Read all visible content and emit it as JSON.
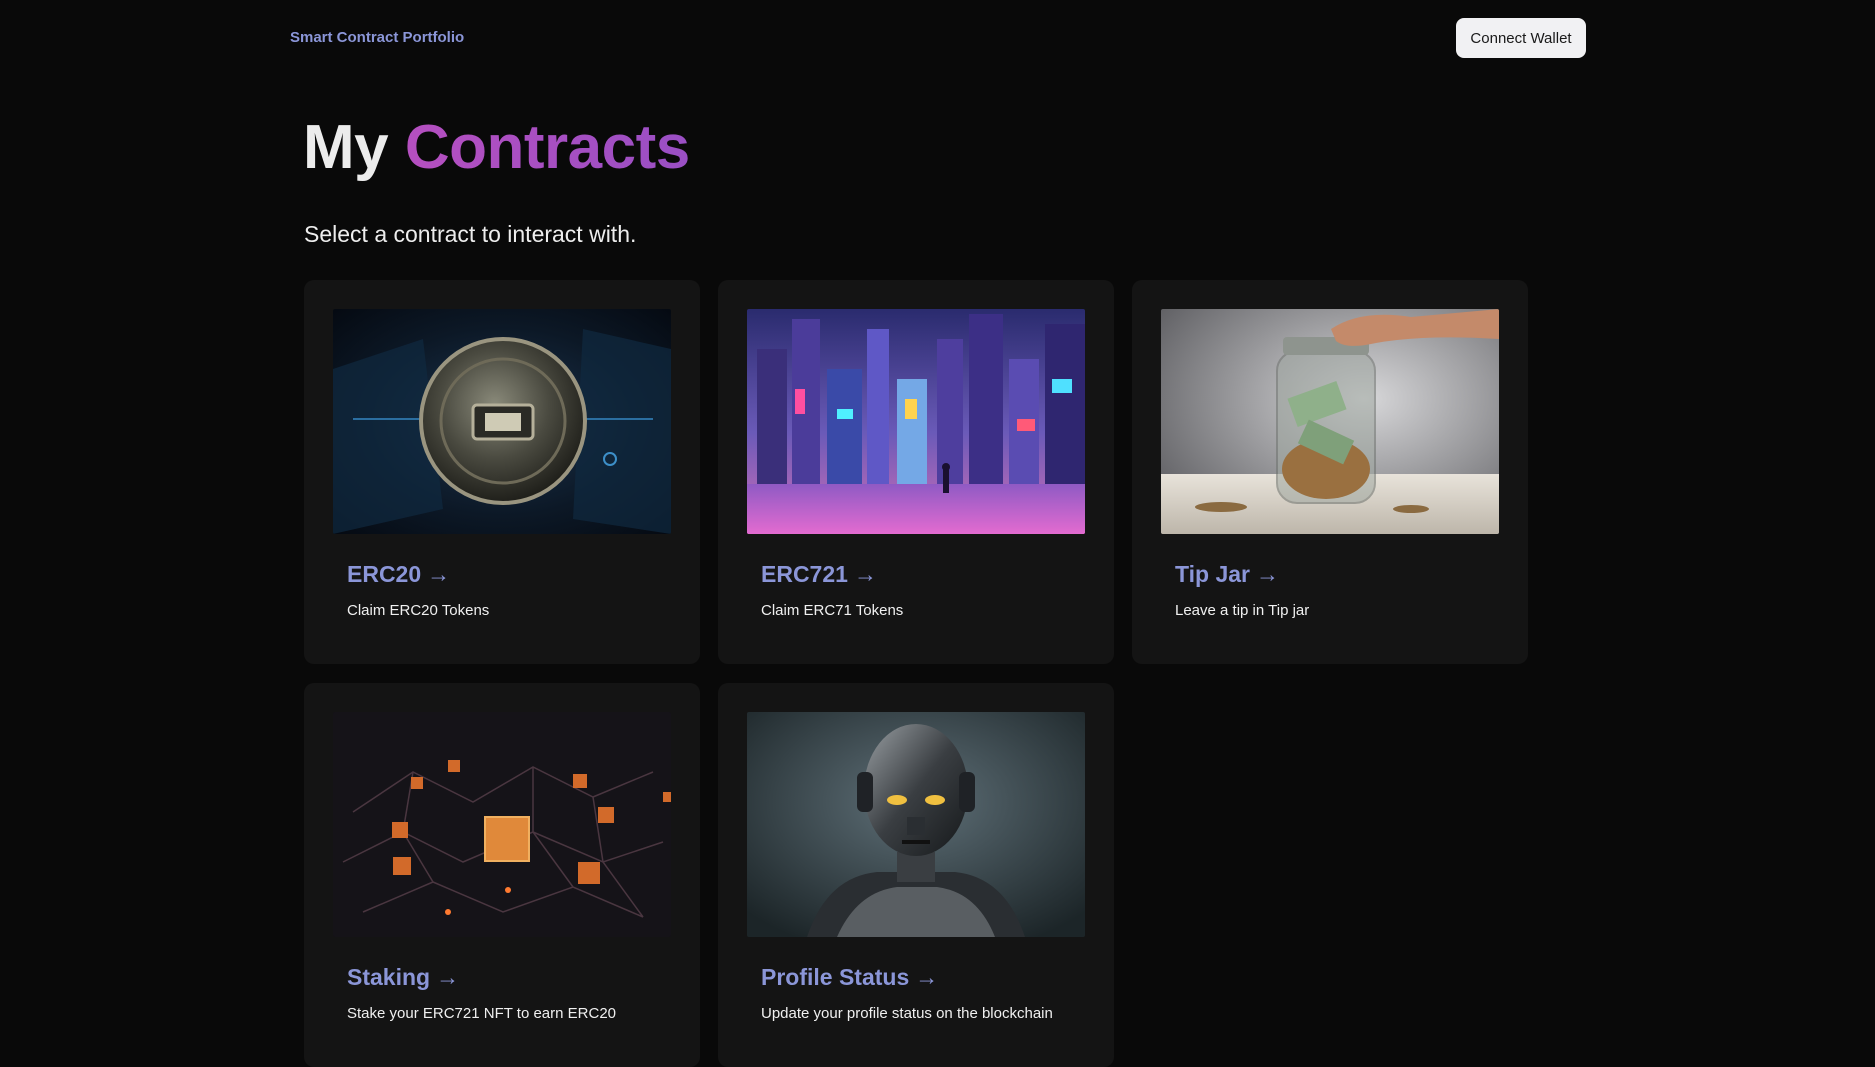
{
  "header": {
    "brand": "Smart Contract Portfolio",
    "connect_label": "Connect Wallet"
  },
  "main": {
    "title_word1": "My",
    "title_word2": "Contracts",
    "subtitle": "Select a contract to interact with."
  },
  "cards": [
    {
      "title": "ERC20",
      "arrow": "→",
      "description": "Claim ERC20 Tokens",
      "image": "coin-image"
    },
    {
      "title": "ERC721",
      "arrow": "→",
      "description": "Claim ERC71 Tokens",
      "image": "cyberpunk-city-image"
    },
    {
      "title": "Tip Jar",
      "arrow": "→",
      "description": "Leave a tip in Tip jar",
      "image": "tip-jar-image"
    },
    {
      "title": "Staking",
      "arrow": "→",
      "description": "Stake your ERC721 NFT to earn ERC20",
      "image": "blockchain-cubes-image"
    },
    {
      "title": "Profile Status",
      "arrow": "→",
      "description": "Update your profile status on the blockchain",
      "image": "robot-image"
    }
  ],
  "colors": {
    "background": "#090909",
    "card": "#141414",
    "accent": "#8b96d8",
    "title_gradient": "#b54fc0"
  }
}
